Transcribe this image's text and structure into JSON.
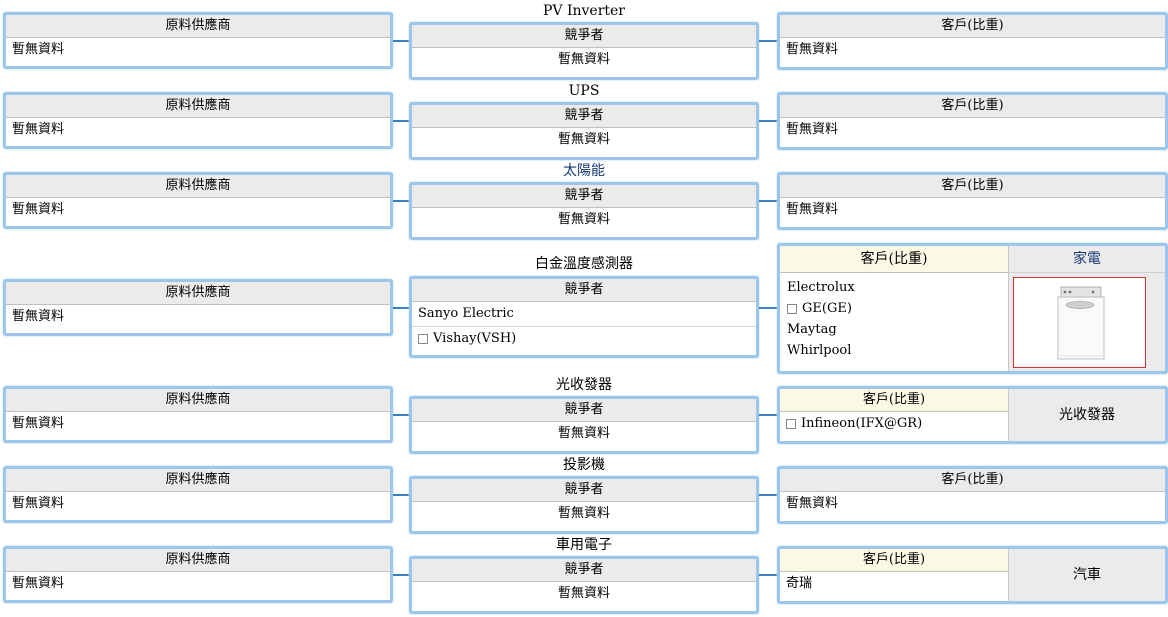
{
  "labels": {
    "supplier": "原料供應商",
    "competitor": "競爭者",
    "customer": "客戶(比重)",
    "no_data": "暫無資料"
  },
  "colors": {
    "connector": "#3d7ec0",
    "box_border": "#9cc6ea",
    "header_bg": "#ebebeb",
    "customer_header_bg": "#fbf8e4"
  },
  "rows": [
    {
      "title": "PV Inverter"
    },
    {
      "title": "UPS"
    },
    {
      "title": "太陽能"
    },
    {
      "title": "白金溫度感測器",
      "competitors": [
        "Sanyo Electric",
        "Vishay(VSH)"
      ],
      "customers": [
        "Electrolux",
        "GE(GE)",
        "Maytag",
        "Whirlpool"
      ],
      "category": "家電",
      "category_icon": "washing-machine-icon"
    },
    {
      "title": "光收發器",
      "customers": [
        "Infineon(IFX@GR)"
      ],
      "category": "光收發器"
    },
    {
      "title": "投影機"
    },
    {
      "title": "車用電子",
      "customers": [
        "奇瑞"
      ],
      "category": "汽車"
    }
  ]
}
